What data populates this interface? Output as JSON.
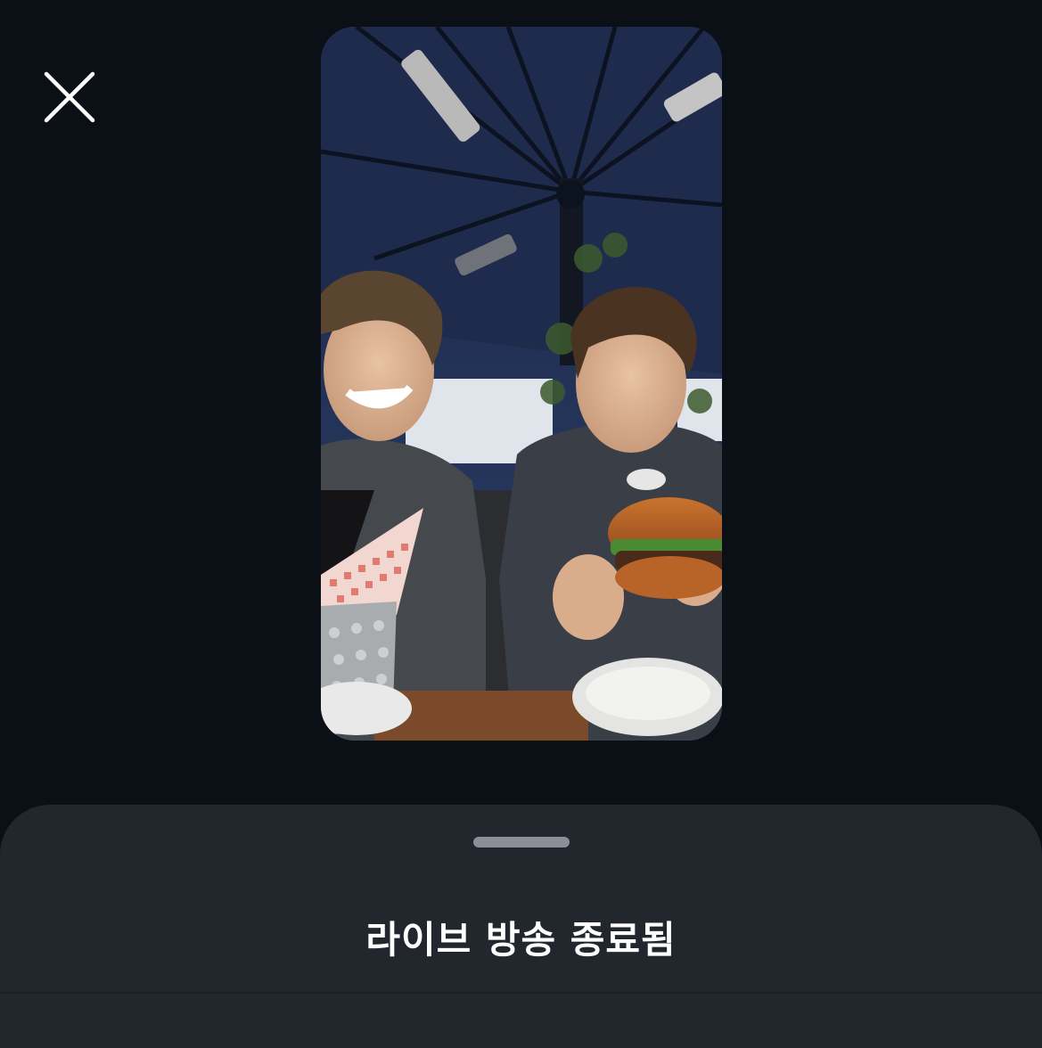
{
  "close_button": {
    "icon": "close-icon",
    "color": "#ffffff"
  },
  "video_preview": {
    "description_icon": "live-video-thumbnail"
  },
  "sheet": {
    "title": "라이브 방송 종료됨",
    "background": "#22262d",
    "handle_color": "#8b9098"
  },
  "colors": {
    "page_background": "#0b0f16",
    "umbrella": "#1e2b4d",
    "text": "#ffffff"
  }
}
